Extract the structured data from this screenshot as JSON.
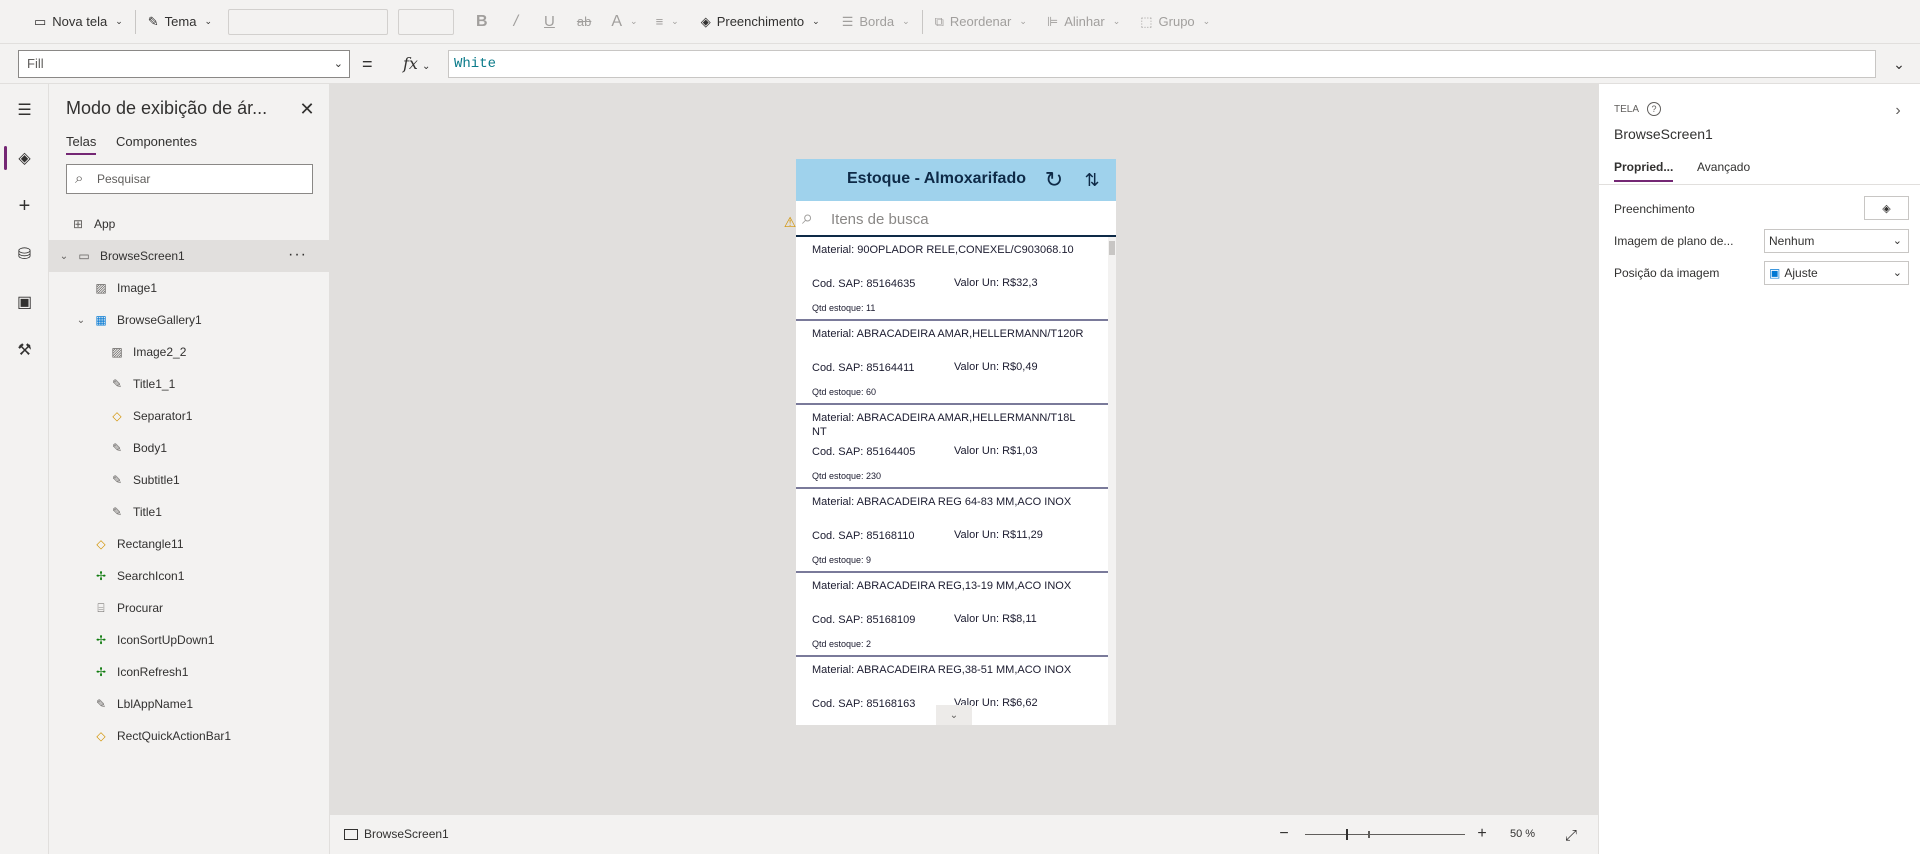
{
  "toolbar": {
    "new_screen": "Nova tela",
    "theme": "Tema",
    "fill": "Preenchimento",
    "border": "Borda",
    "reorder": "Reordenar",
    "align": "Alinhar",
    "group": "Grupo"
  },
  "formula": {
    "property": "Fill",
    "equals": "=",
    "fx": "fx",
    "value": "White"
  },
  "tree": {
    "title": "Modo de exibição de ár...",
    "tabs": [
      "Telas",
      "Componentes"
    ],
    "search_placeholder": "Pesquisar",
    "items": [
      {
        "label": "App",
        "icon": "app-icon",
        "level": 0
      },
      {
        "label": "BrowseScreen1",
        "icon": "screen-icon",
        "level": 0,
        "expand": "collapse",
        "selected": true
      },
      {
        "label": "Image1",
        "icon": "image-icon",
        "level": 1
      },
      {
        "label": "BrowseGallery1",
        "icon": "gallery-icon",
        "level": 1,
        "expand": "collapse"
      },
      {
        "label": "Image2_2",
        "icon": "image-icon",
        "level": 2
      },
      {
        "label": "Title1_1",
        "icon": "label-icon",
        "level": 2
      },
      {
        "label": "Separator1",
        "icon": "shape-icon",
        "level": 2
      },
      {
        "label": "Body1",
        "icon": "label-icon",
        "level": 2
      },
      {
        "label": "Subtitle1",
        "icon": "label-icon",
        "level": 2
      },
      {
        "label": "Title1",
        "icon": "label-icon",
        "level": 2
      },
      {
        "label": "Rectangle11",
        "icon": "shape-icon",
        "level": 1
      },
      {
        "label": "SearchIcon1",
        "icon": "icon-control-icon",
        "level": 1
      },
      {
        "label": "Procurar",
        "icon": "textinput-icon",
        "level": 1
      },
      {
        "label": "IconSortUpDown1",
        "icon": "icon-control-icon",
        "level": 1
      },
      {
        "label": "IconRefresh1",
        "icon": "icon-control-icon",
        "level": 1
      },
      {
        "label": "LblAppName1",
        "icon": "label-icon",
        "level": 1
      },
      {
        "label": "RectQuickActionBar1",
        "icon": "shape-icon",
        "level": 1
      }
    ]
  },
  "app": {
    "title": "Estoque - Almoxarifado",
    "search_placeholder": "Itens de busca",
    "items": [
      {
        "material": "Material: 90OPLADOR RELE,CONEXEL/C903068.10",
        "cod": "Cod. SAP: 85164635",
        "valor": "Valor Un: R$32,3",
        "qtd": "Qtd estoque: 11"
      },
      {
        "material": "Material: ABRACADEIRA AMAR,HELLERMANN/T120R",
        "cod": "Cod. SAP: 85164411",
        "valor": "Valor Un: R$0,49",
        "qtd": "Qtd estoque: 60"
      },
      {
        "material": "Material: ABRACADEIRA AMAR,HELLERMANN/T18L NT",
        "cod": "Cod. SAP: 85164405",
        "valor": "Valor Un: R$1,03",
        "qtd": "Qtd estoque: 230"
      },
      {
        "material": "Material: ABRACADEIRA REG 64-83 MM,ACO INOX",
        "cod": "Cod. SAP: 85168110",
        "valor": "Valor Un: R$11,29",
        "qtd": "Qtd estoque: 9"
      },
      {
        "material": "Material: ABRACADEIRA REG,13-19 MM,ACO INOX",
        "cod": "Cod. SAP: 85168109",
        "valor": "Valor Un: R$8,11",
        "qtd": "Qtd estoque: 2"
      },
      {
        "material": "Material: ABRACADEIRA REG,38-51 MM,ACO INOX",
        "cod": "Cod. SAP: 85168163",
        "valor": "Valor Un: R$6,62",
        "qtd": ""
      }
    ]
  },
  "status": {
    "screen": "BrowseScreen1",
    "zoom": "50  %"
  },
  "properties": {
    "kind": "TELA",
    "name": "BrowseScreen1",
    "tabs": [
      "Propried...",
      "Avançado"
    ],
    "fill_label": "Preenchimento",
    "bg_image_label": "Imagem de plano de...",
    "bg_image_value": "Nenhum",
    "image_pos_label": "Posição da imagem",
    "image_pos_value": "Ajuste"
  },
  "colors": {
    "accent": "#742774",
    "app_header": "#9fd2ec",
    "app_title": "#0e2a47",
    "formula_text": "#0b7b8a"
  }
}
